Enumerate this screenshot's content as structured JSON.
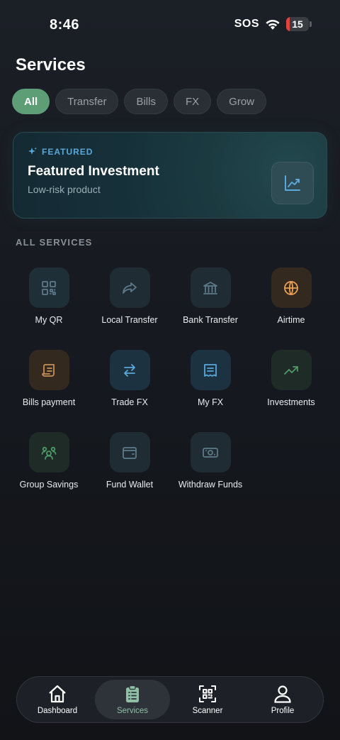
{
  "status_bar": {
    "time": "8:46",
    "carrier": "SOS",
    "battery_level": "15",
    "battery_fraction": 0.15
  },
  "title": "Services",
  "filters": [
    "All",
    "Transfer",
    "Bills",
    "FX",
    "Grow"
  ],
  "active_filter": "All",
  "featured": {
    "tag": "FEATURED",
    "title": "Featured Investment",
    "subtitle": "Low-risk product",
    "icon": "trending-chart-icon"
  },
  "section_label": "ALL SERVICES",
  "services": [
    {
      "label": "My QR",
      "icon": "qr-code-icon",
      "color": "#5d7a8a",
      "bg": "#1f2f37"
    },
    {
      "label": "Local Transfer",
      "icon": "share-arrow-icon",
      "color": "#5d7a8a",
      "bg": "#1f2c33"
    },
    {
      "label": "Bank Transfer",
      "icon": "bank-icon",
      "color": "#5d7a8a",
      "bg": "#1f2c33"
    },
    {
      "label": "Airtime",
      "icon": "globe-icon",
      "color": "#e8a155",
      "bg": "#33291f"
    },
    {
      "label": "Bills payment",
      "icon": "receipt-scroll-icon",
      "color": "#c49058",
      "bg": "#33291f"
    },
    {
      "label": "Trade FX",
      "icon": "swap-arrows-icon",
      "color": "#5aa7d8",
      "bg": "#1d3241"
    },
    {
      "label": "My FX",
      "icon": "receipt-icon",
      "color": "#5aa7d8",
      "bg": "#1d3241"
    },
    {
      "label": "Investments",
      "icon": "trending-up-icon",
      "color": "#4f9a6a",
      "bg": "#1e2b26"
    },
    {
      "label": "Group Savings",
      "icon": "group-icon",
      "color": "#4f9a6a",
      "bg": "#1e2b26"
    },
    {
      "label": "Fund Wallet",
      "icon": "wallet-icon",
      "color": "#5d7a8a",
      "bg": "#1f2c33"
    },
    {
      "label": "Withdraw Funds",
      "icon": "cash-icon",
      "color": "#5d7a8a",
      "bg": "#1f2c33"
    }
  ],
  "bottom_nav": [
    {
      "label": "Dashboard",
      "icon": "home-icon"
    },
    {
      "label": "Services",
      "icon": "clipboard-list-icon"
    },
    {
      "label": "Scanner",
      "icon": "qr-scan-icon"
    },
    {
      "label": "Profile",
      "icon": "user-icon"
    }
  ],
  "active_nav": "Services",
  "colors": {
    "accent": "#5e9e77",
    "featured_tag": "#5aa7d8",
    "battery_low": "#e0443e"
  }
}
